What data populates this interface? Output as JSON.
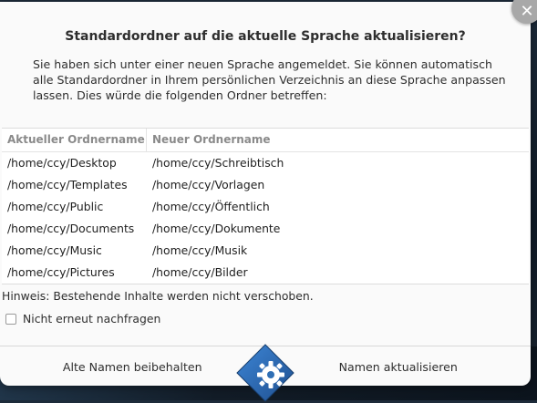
{
  "dialog": {
    "title": "Standardordner auf die aktuelle Sprache aktualisieren?",
    "description": "Sie haben sich unter einer neuen Sprache angemeldet. Sie können automatisch alle Standardordner in Ihrem persönlichen Verzeichnis an diese Sprache anpassen lassen. Dies würde die folgenden Ordner betreffen:",
    "close_glyph": "✕"
  },
  "table": {
    "headers": [
      "Aktueller Ordnername",
      "Neuer Ordnername"
    ],
    "rows": [
      [
        "/home/ccy/Desktop",
        "/home/ccy/Schreibtisch"
      ],
      [
        "/home/ccy/Templates",
        "/home/ccy/Vorlagen"
      ],
      [
        "/home/ccy/Public",
        "/home/ccy/Öffentlich"
      ],
      [
        "/home/ccy/Documents",
        "/home/ccy/Dokumente"
      ],
      [
        "/home/ccy/Music",
        "/home/ccy/Musik"
      ],
      [
        "/home/ccy/Pictures",
        "/home/ccy/Bilder"
      ]
    ]
  },
  "hint": "Hinweis: Bestehende Inhalte werden nicht verschoben.",
  "checkbox": {
    "label": "Nicht erneut nachfragen",
    "checked": false
  },
  "actions": {
    "keep_label": "Alte Namen beibehalten",
    "update_label": "Namen aktualisieren"
  },
  "colors": {
    "dialog_bg": "#fafafa",
    "text": "#2e2e2e",
    "header_text": "#8a8a8a",
    "logo_blue": "#2f6fb5"
  },
  "icons": {
    "close": "close-icon",
    "logo": "gear-diamond-logo-icon"
  }
}
